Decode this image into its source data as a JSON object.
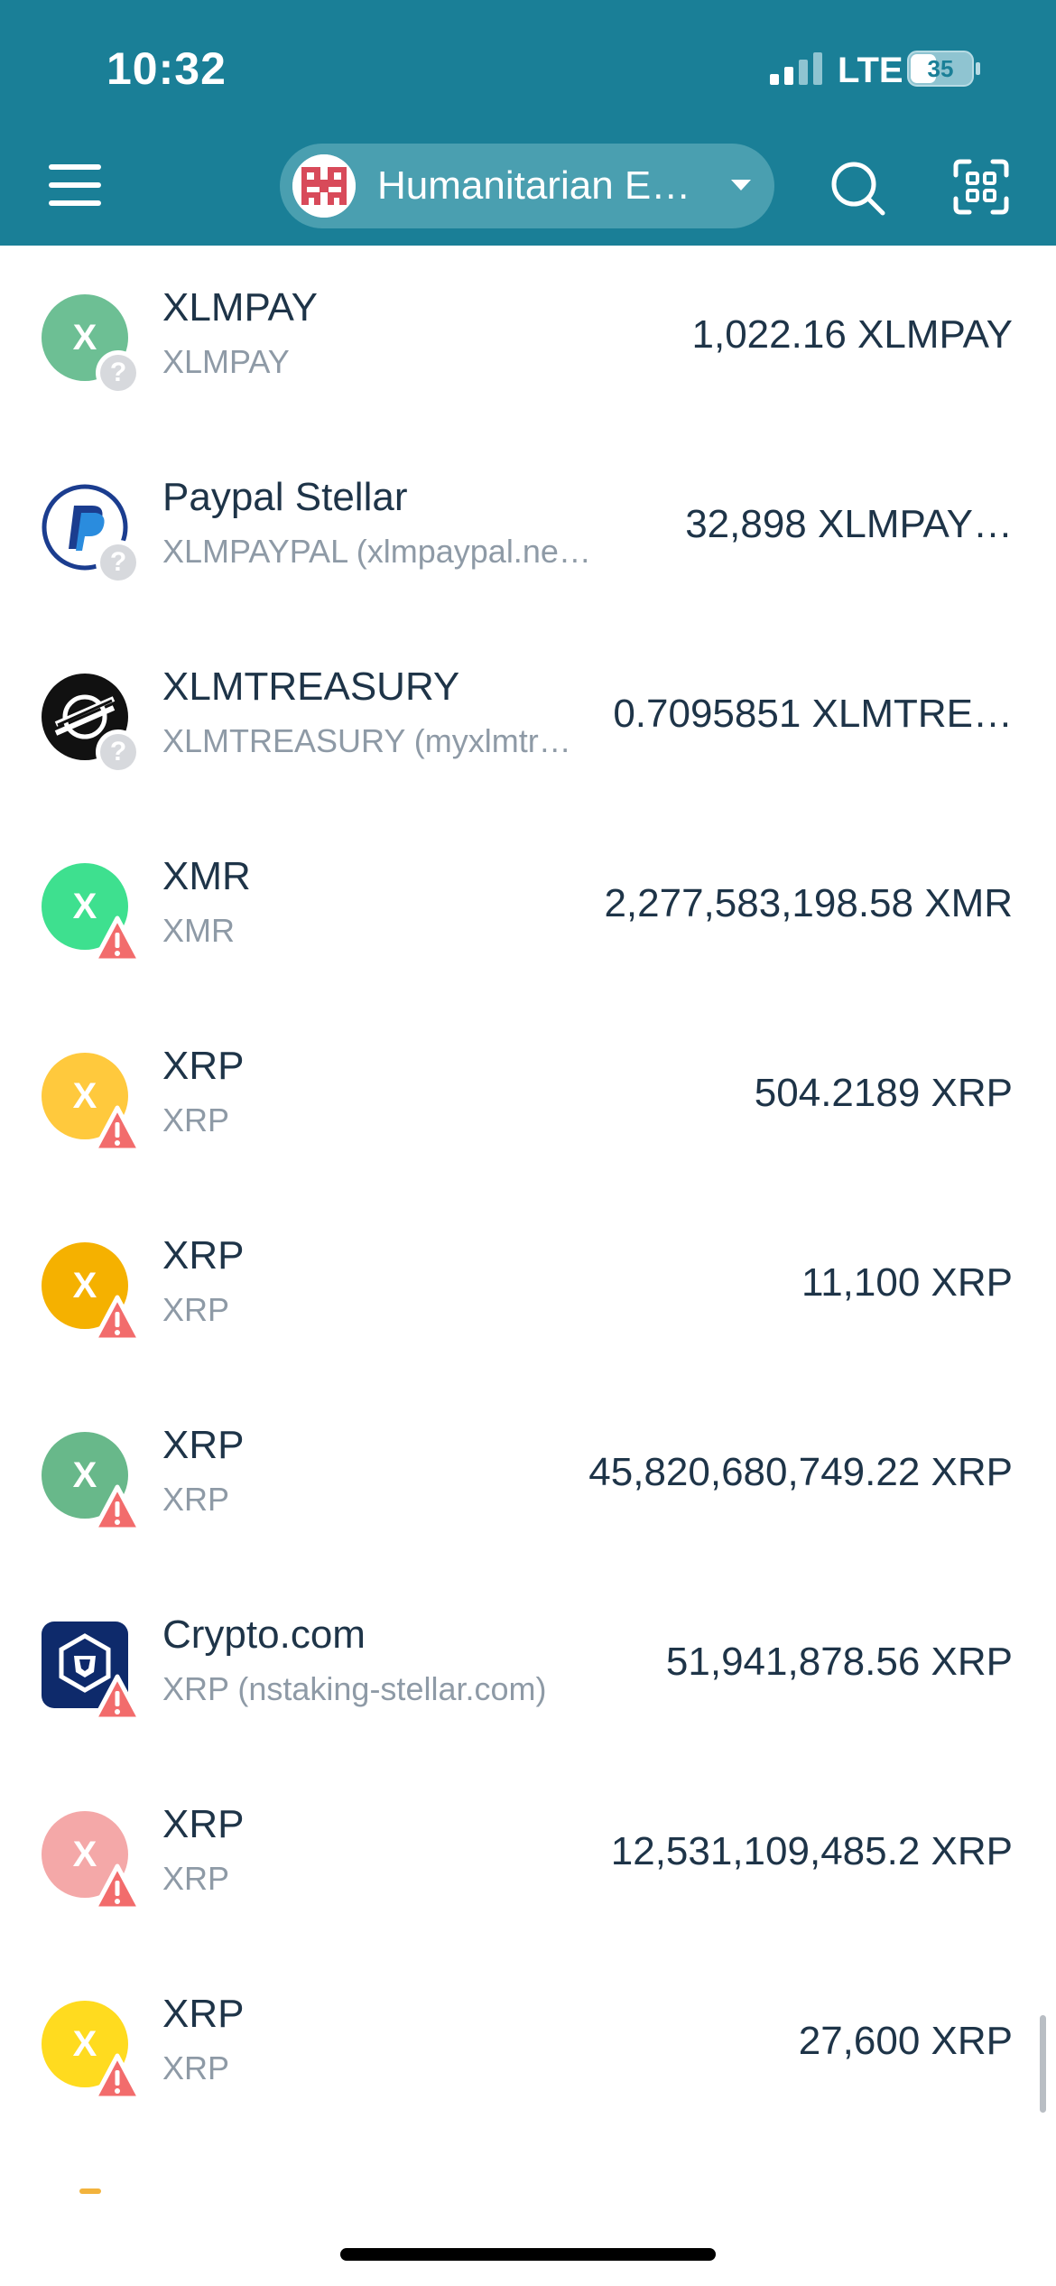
{
  "status_bar": {
    "time": "10:32",
    "network": "LTE",
    "battery": "35"
  },
  "header": {
    "wallet_name": "Humanitarian E…"
  },
  "colors": {
    "header_bg": "#1a7f97",
    "warning": "#f26c6c"
  },
  "tokens": [
    {
      "name": "XLMPAY",
      "subtitle": "XLMPAY",
      "amount": "1,022.16 XLMPAY",
      "icon": "x-coin-icon",
      "icon_letter": "X",
      "color": "#6dbf94",
      "badge": "question"
    },
    {
      "name": "Paypal Stellar",
      "subtitle": "XLMPAYPAL (xlmpaypal.netlif…",
      "amount": "32,898 XLMPAY…",
      "icon": "paypal-icon",
      "icon_letter": "",
      "color": "#ffffff",
      "badge": "question"
    },
    {
      "name": "XLMTREASURY",
      "subtitle": "XLMTREASURY (myxlmtr…",
      "amount": "0.7095851 XLMTRE…",
      "icon": "stellar-icon",
      "icon_letter": "",
      "color": "#111111",
      "badge": "question"
    },
    {
      "name": "XMR",
      "subtitle": "XMR",
      "amount": "2,277,583,198.58 XMR",
      "icon": "x-coin-icon",
      "icon_letter": "X",
      "color": "#3ee08f",
      "badge": "warning"
    },
    {
      "name": "XRP",
      "subtitle": "XRP",
      "amount": "504.2189 XRP",
      "icon": "x-coin-icon",
      "icon_letter": "X",
      "color": "#ffc93d",
      "badge": "warning"
    },
    {
      "name": "XRP",
      "subtitle": "XRP",
      "amount": "11,100 XRP",
      "icon": "x-coin-icon",
      "icon_letter": "X",
      "color": "#f5b100",
      "badge": "warning"
    },
    {
      "name": "XRP",
      "subtitle": "XRP",
      "amount": "45,820,680,749.22 XRP",
      "icon": "x-coin-icon",
      "icon_letter": "X",
      "color": "#68b88a",
      "badge": "warning"
    },
    {
      "name": "Crypto.com",
      "subtitle": "XRP (nstaking-stellar.com)",
      "amount": "51,941,878.56 XRP",
      "icon": "crypto-com-icon",
      "icon_letter": "",
      "color": "#0e2a6b",
      "badge": "warning"
    },
    {
      "name": "XRP",
      "subtitle": "XRP",
      "amount": "12,531,109,485.2 XRP",
      "icon": "x-coin-icon",
      "icon_letter": "X",
      "color": "#f4a8a8",
      "badge": "warning"
    },
    {
      "name": "XRP",
      "subtitle": "XRP",
      "amount": "27,600 XRP",
      "icon": "x-coin-icon",
      "icon_letter": "X",
      "color": "#ffdb1f",
      "badge": "warning"
    }
  ]
}
